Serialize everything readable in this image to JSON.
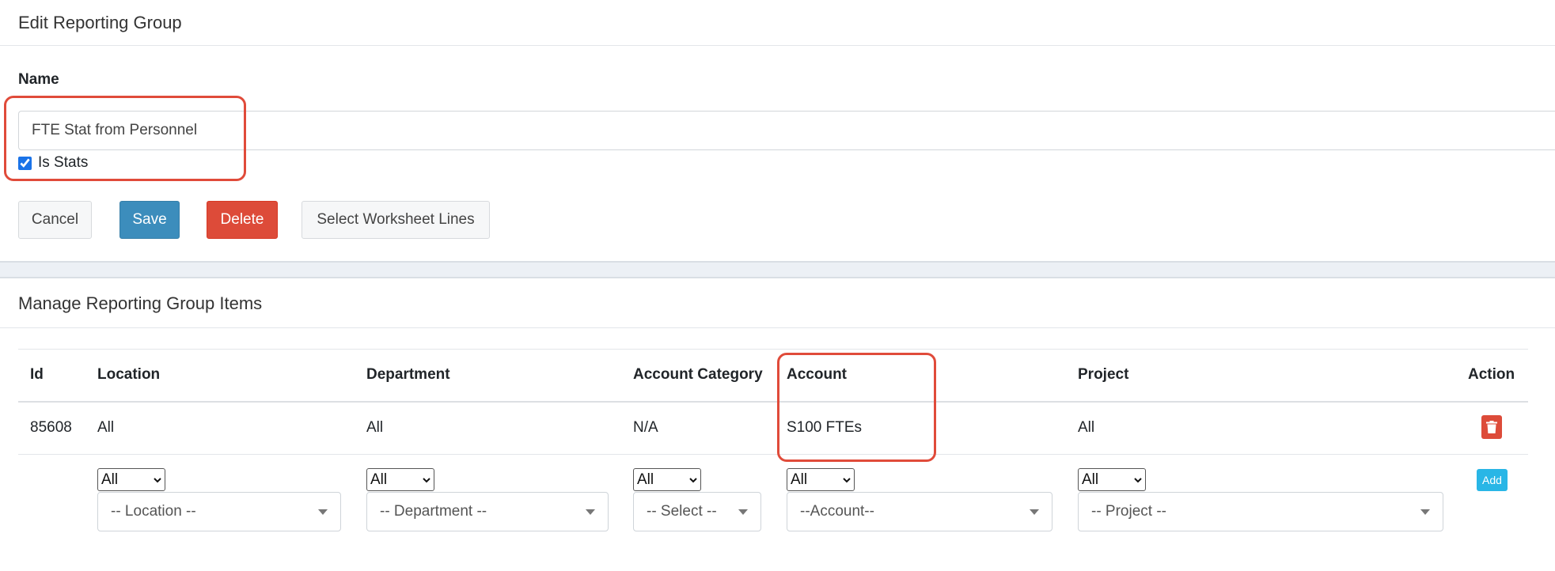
{
  "edit_panel": {
    "title": "Edit Reporting Group",
    "name_label": "Name",
    "name_value": "FTE Stat from Personnel",
    "is_stats_label": "Is Stats",
    "is_stats_checked": true,
    "buttons": {
      "cancel": "Cancel",
      "save": "Save",
      "delete": "Delete",
      "select_lines": "Select Worksheet Lines"
    }
  },
  "items_panel": {
    "title": "Manage Reporting Group Items",
    "columns": [
      "Id",
      "Location",
      "Department",
      "Account Category",
      "Account",
      "Project",
      "Action"
    ],
    "rows": [
      {
        "id": "85608",
        "location": "All",
        "department": "All",
        "account_category": "N/A",
        "account": "S100 FTEs",
        "project": "All",
        "action_icon": "trash-icon"
      }
    ],
    "new_row": {
      "selects": {
        "location": "All",
        "department": "All",
        "account_category": "All",
        "account": "All",
        "project": "All"
      },
      "dropdowns": {
        "location": "-- Location --",
        "department": "-- Department --",
        "account_category": "-- Select --",
        "account": "--Account--",
        "project": "-- Project --"
      },
      "add_label": "Add"
    }
  },
  "colors": {
    "save": "#3c8dbc",
    "delete": "#dd4b39",
    "add": "#29b6e6",
    "highlight": "#e04b3a"
  }
}
